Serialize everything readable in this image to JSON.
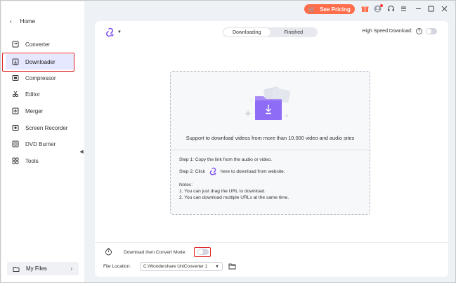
{
  "sidebar": {
    "home_label": "Home",
    "items": [
      {
        "label": "Converter",
        "icon": "converter-icon"
      },
      {
        "label": "Downloader",
        "icon": "downloader-icon"
      },
      {
        "label": "Compressor",
        "icon": "compressor-icon"
      },
      {
        "label": "Editor",
        "icon": "editor-icon"
      },
      {
        "label": "Merger",
        "icon": "merger-icon"
      },
      {
        "label": "Screen Recorder",
        "icon": "screen-recorder-icon"
      },
      {
        "label": "DVD Burner",
        "icon": "dvd-icon"
      },
      {
        "label": "Tools",
        "icon": "tools-icon"
      }
    ],
    "active_item": "Downloader",
    "my_files_label": "My Files"
  },
  "topbar": {
    "see_pricing_label": "See Pricing",
    "accent_color": "#ff6d4a"
  },
  "main": {
    "tabs": [
      {
        "label": "Downloading",
        "active": true
      },
      {
        "label": "Finished",
        "active": false
      }
    ],
    "high_speed_label": "High Speed Download:",
    "high_speed_enabled": false,
    "support_text": "Support to download videos from more than 10.000 video and audio sites",
    "step1": "Step 1: Copy the link from the audio or video.",
    "step2_prefix": "Step 2: Click",
    "step2_suffix": "here to download from website.",
    "notes_title": "Notes:",
    "note1": "1. You can just drag the URL to download.",
    "note2": "2. You can download multiple URLs at the same time.",
    "convert_mode_label": "Download then Convert Mode:",
    "convert_mode_enabled": false,
    "file_location_label": "File Location:",
    "file_location_value": "C:\\Wondershare UniConverter 1",
    "brand_color": "#7b4cf5"
  }
}
